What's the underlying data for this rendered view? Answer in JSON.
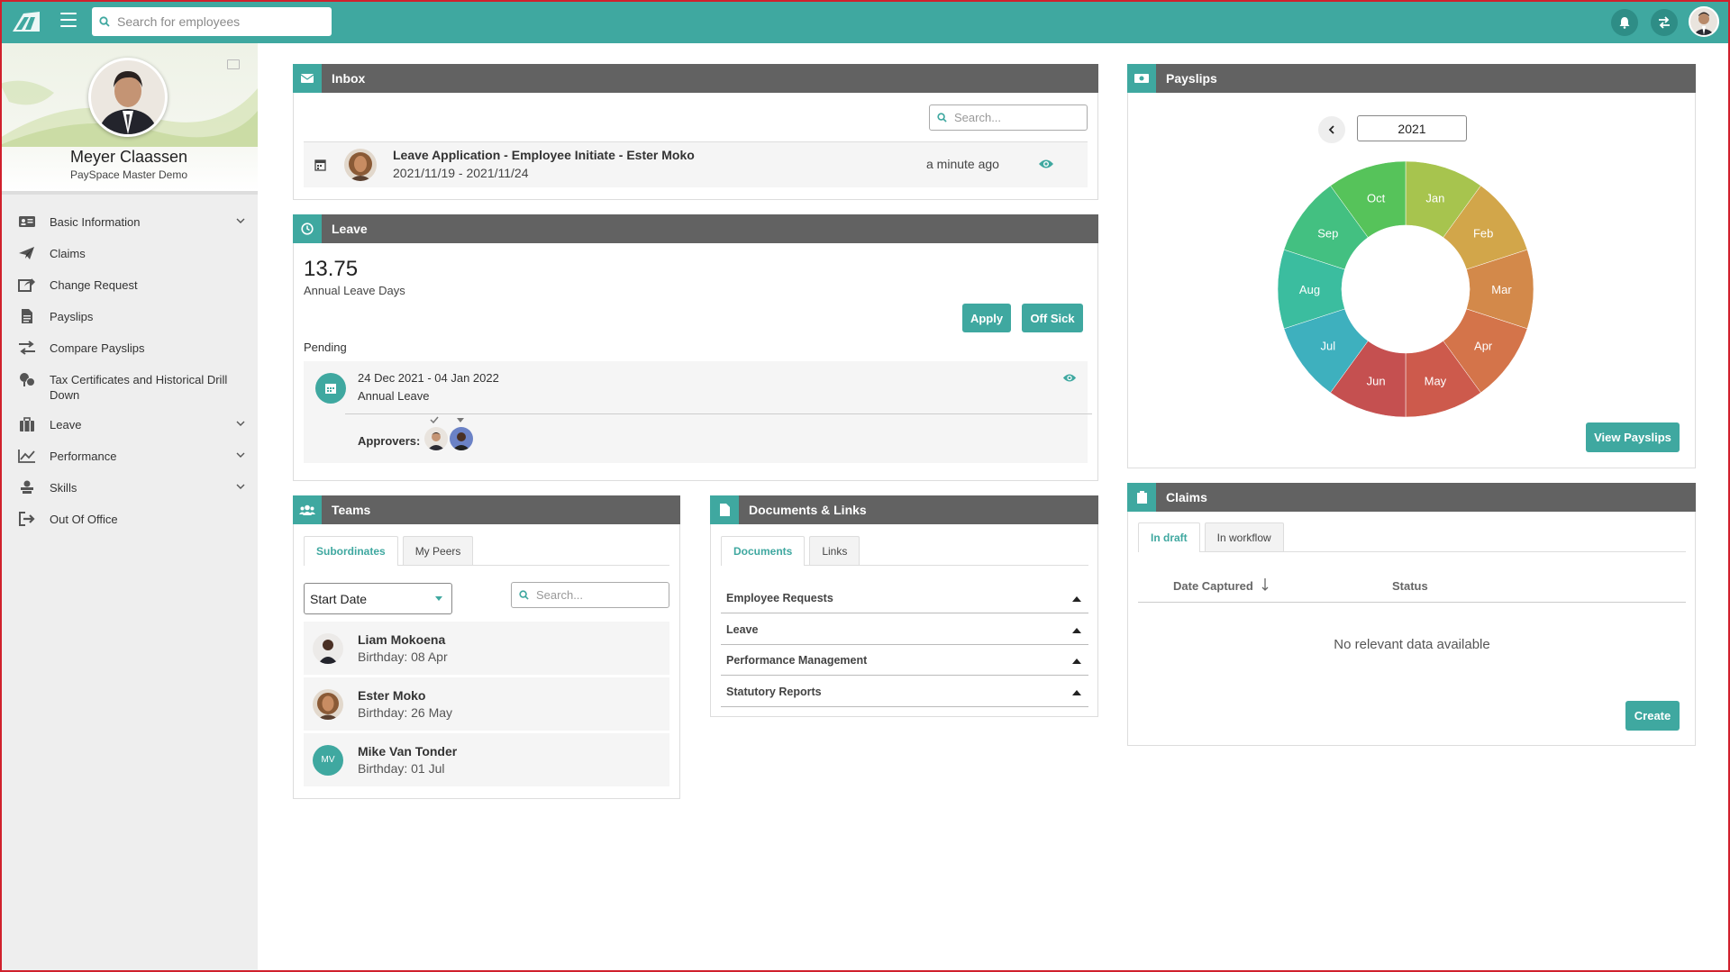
{
  "topbar": {
    "search_placeholder": "Search for employees",
    "icons": [
      "notification-bell-icon",
      "switch-icon"
    ]
  },
  "profile": {
    "name": "Meyer Claassen",
    "company": "PaySpace Master Demo"
  },
  "sidebar": {
    "items": [
      {
        "label": "Basic Information",
        "icon": "id-card-icon",
        "expandable": true
      },
      {
        "label": "Claims",
        "icon": "paper-plane-icon",
        "expandable": false
      },
      {
        "label": "Change Request",
        "icon": "share-icon",
        "expandable": false
      },
      {
        "label": "Payslips",
        "icon": "document-icon",
        "expandable": false
      },
      {
        "label": "Compare Payslips",
        "icon": "exchange-icon",
        "expandable": false
      },
      {
        "label": "Tax Certificates and Historical Drill Down",
        "icon": "tax-icon",
        "expandable": false
      },
      {
        "label": "Leave",
        "icon": "briefcase-icon",
        "expandable": true
      },
      {
        "label": "Performance",
        "icon": "chart-line-icon",
        "expandable": true
      },
      {
        "label": "Skills",
        "icon": "skills-icon",
        "expandable": true
      },
      {
        "label": "Out Of Office",
        "icon": "sign-out-icon",
        "expandable": false
      }
    ]
  },
  "inbox": {
    "title": "Inbox",
    "search_placeholder": "Search...",
    "item": {
      "title": "Leave Application - Employee Initiate - Ester Moko",
      "dates": "2021/11/19 - 2021/11/24",
      "time": "a minute ago"
    }
  },
  "leave": {
    "title": "Leave",
    "days": "13.75",
    "days_label": "Annual Leave Days",
    "apply_label": "Apply",
    "off_sick_label": "Off Sick",
    "pending_label": "Pending",
    "pending_item": {
      "dates": "24 Dec 2021 - 04 Jan 2022",
      "type": "Annual Leave",
      "approvers_label": "Approvers:"
    }
  },
  "teams": {
    "title": "Teams",
    "tabs": [
      "Subordinates",
      "My Peers"
    ],
    "filter_value": "Start Date",
    "search_placeholder": "Search...",
    "members": [
      {
        "name": "Liam Mokoena",
        "sub": "Birthday: 08 Apr"
      },
      {
        "name": "Ester Moko",
        "sub": "Birthday: 26 May"
      },
      {
        "name": "Mike Van Tonder",
        "sub": "Birthday: 01 Jul",
        "initials": "MV"
      }
    ]
  },
  "documents": {
    "title": "Documents & Links",
    "tabs": [
      "Documents",
      "Links"
    ],
    "rows": [
      "Employee Requests",
      "Leave",
      "Performance Management",
      "Statutory Reports"
    ]
  },
  "payslips": {
    "title": "Payslips",
    "year": "2021",
    "view_label": "View Payslips",
    "months": [
      {
        "label": "Jan",
        "color": "#a7c44e"
      },
      {
        "label": "Feb",
        "color": "#d2a64a"
      },
      {
        "label": "Mar",
        "color": "#d3894a"
      },
      {
        "label": "Apr",
        "color": "#d4744a"
      },
      {
        "label": "May",
        "color": "#cd5a4c"
      },
      {
        "label": "Jun",
        "color": "#c55050"
      },
      {
        "label": "Jul",
        "color": "#3eb0be"
      },
      {
        "label": "Aug",
        "color": "#3bbd9f"
      },
      {
        "label": "Sep",
        "color": "#43c081"
      },
      {
        "label": "Oct",
        "color": "#56c35a"
      }
    ]
  },
  "claims": {
    "title": "Claims",
    "tabs": [
      "In draft",
      "In workflow"
    ],
    "col_date": "Date Captured",
    "col_status": "Status",
    "empty": "No relevant data available",
    "create_label": "Create"
  }
}
